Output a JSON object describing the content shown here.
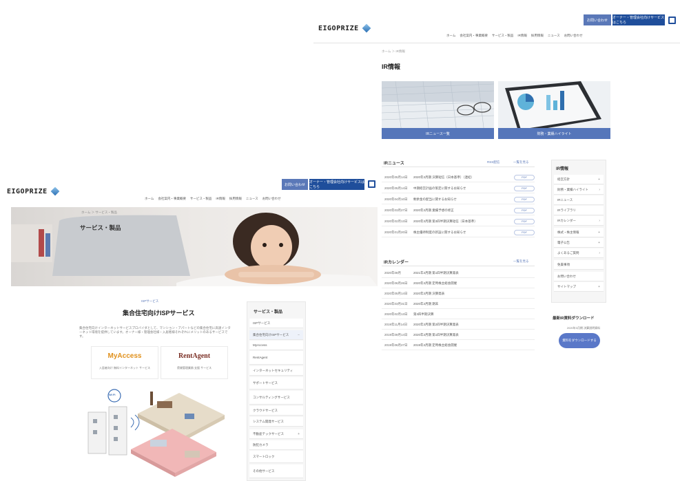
{
  "logo_text": "EIGOPRIZE",
  "right": {
    "topbar": {
      "btn1": "お問い合わせ",
      "btn2": "オーナー・管理会社向けサービスはこちら"
    },
    "nav": [
      "ホーム",
      "会社案内・事業概要",
      "サービス・製品",
      "IR情報",
      "採用情報",
      "ニュース",
      "お問い合わせ"
    ],
    "breadcrumb": "ホーム ＞ IR情報",
    "page_title": "IR情報",
    "banner_left_label": "IRニュース一覧",
    "banner_right_label": "財務・業績ハイライト",
    "ir_news": {
      "heading": "IRニュース",
      "more1": "RSS配信",
      "more2": "一覧を見る",
      "rows": [
        {
          "date": "2020年05月14日",
          "title": "2020年3月期 決算短信〔日本基準〕（連結）",
          "badge": "PDF"
        },
        {
          "date": "2020年05月14日",
          "title": "中期経営計画の策定に関するお知らせ",
          "badge": "PDF"
        },
        {
          "date": "2020年04月10日",
          "title": "剰余金の配当に関するお知らせ",
          "badge": "PDF"
        },
        {
          "date": "2020年03月27日",
          "title": "2020年3月期 業績予想の修正",
          "badge": "PDF"
        },
        {
          "date": "2020年02月13日",
          "title": "2020年3月期 第3四半期決算短信〔日本基準〕",
          "badge": "PDF"
        },
        {
          "date": "2020年01月20日",
          "title": "株主優待制度の新設に関するお知らせ",
          "badge": "PDF"
        }
      ]
    },
    "ir_calendar": {
      "heading": "IRカレンダー",
      "more": "一覧を見る",
      "rows": [
        {
          "date": "2020年08月",
          "title": "2021年3月期 第1四半期決算発表"
        },
        {
          "date": "2020年06月26日",
          "title": "2020年3月期 定時株主総会開催"
        },
        {
          "date": "2020年05月14日",
          "title": "2020年3月期 決算発表"
        },
        {
          "date": "2020年03月31日",
          "title": "2020年3月期 期末"
        },
        {
          "date": "2020年02月13日",
          "title": "第3四半期決算"
        },
        {
          "date": "2019年11月14日",
          "title": "2020年3月期 第2四半期決算発表"
        },
        {
          "date": "2019年08月14日",
          "title": "2020年3月期 第1四半期決算発表"
        },
        {
          "date": "2019年06月27日",
          "title": "2019年3月期 定時株主総会開催"
        }
      ]
    },
    "sidebar": {
      "title": "IR情報",
      "items": [
        "経営方針",
        "財務・業績ハイライト",
        "IRニュース",
        "IRライブラリ",
        "IRカレンダー",
        "株式・株主情報",
        "電子公告",
        "よくあるご質問",
        "免責事項",
        "お問い合わせ",
        "サイトマップ"
      ],
      "download_title": "最新IR資料ダウンロード",
      "download_caption": "2020年3月期 決算説明資料",
      "download_btn": "資料をダウンロードする"
    }
  },
  "left": {
    "topbar": {
      "btn1": "お問い合わせ",
      "btn2": "オーナー・管理会社向けサービスはこちら"
    },
    "nav": [
      "ホーム",
      "会社案内・事業概要",
      "サービス・製品",
      "IR情報",
      "採用情報",
      "ニュース",
      "お問い合わせ"
    ],
    "breadcrumb": "ホーム ＞ サービス・製品",
    "hero_title": "サービス・製品",
    "sub_label": "ISPサービス",
    "section_title": "集合住宅向けISPサービス",
    "paragraph": "集合住宅向けインターネットサービスプロバイダとして、マンション・アパートなどの集合住宅に高速インターネット環境を提供しています。オーナー様・管理会社様・入居者様それぞれにメリットのあるサービスです。",
    "logo1": {
      "brand": "MyAccess",
      "caption": "入居者向け 無料インターネット サービス"
    },
    "logo2": {
      "brand": "RentAgent",
      "caption": "賃貸管理業務 支援 サービス"
    },
    "wifi_label": "Wi Fi",
    "sidebar": {
      "title": "サービス・製品",
      "items": [
        "ISPサービス",
        "集合住宅向けISPサービス",
        "MyAccess",
        "RentAgent",
        "インターネットセキュリティ",
        "サポートサービス",
        "コンサルティングサービス",
        "クラウドサービス",
        "システム開発サービス",
        "不動産テックサービス",
        "防犯カメラ",
        "スマートロック",
        "その他サービス"
      ]
    }
  }
}
